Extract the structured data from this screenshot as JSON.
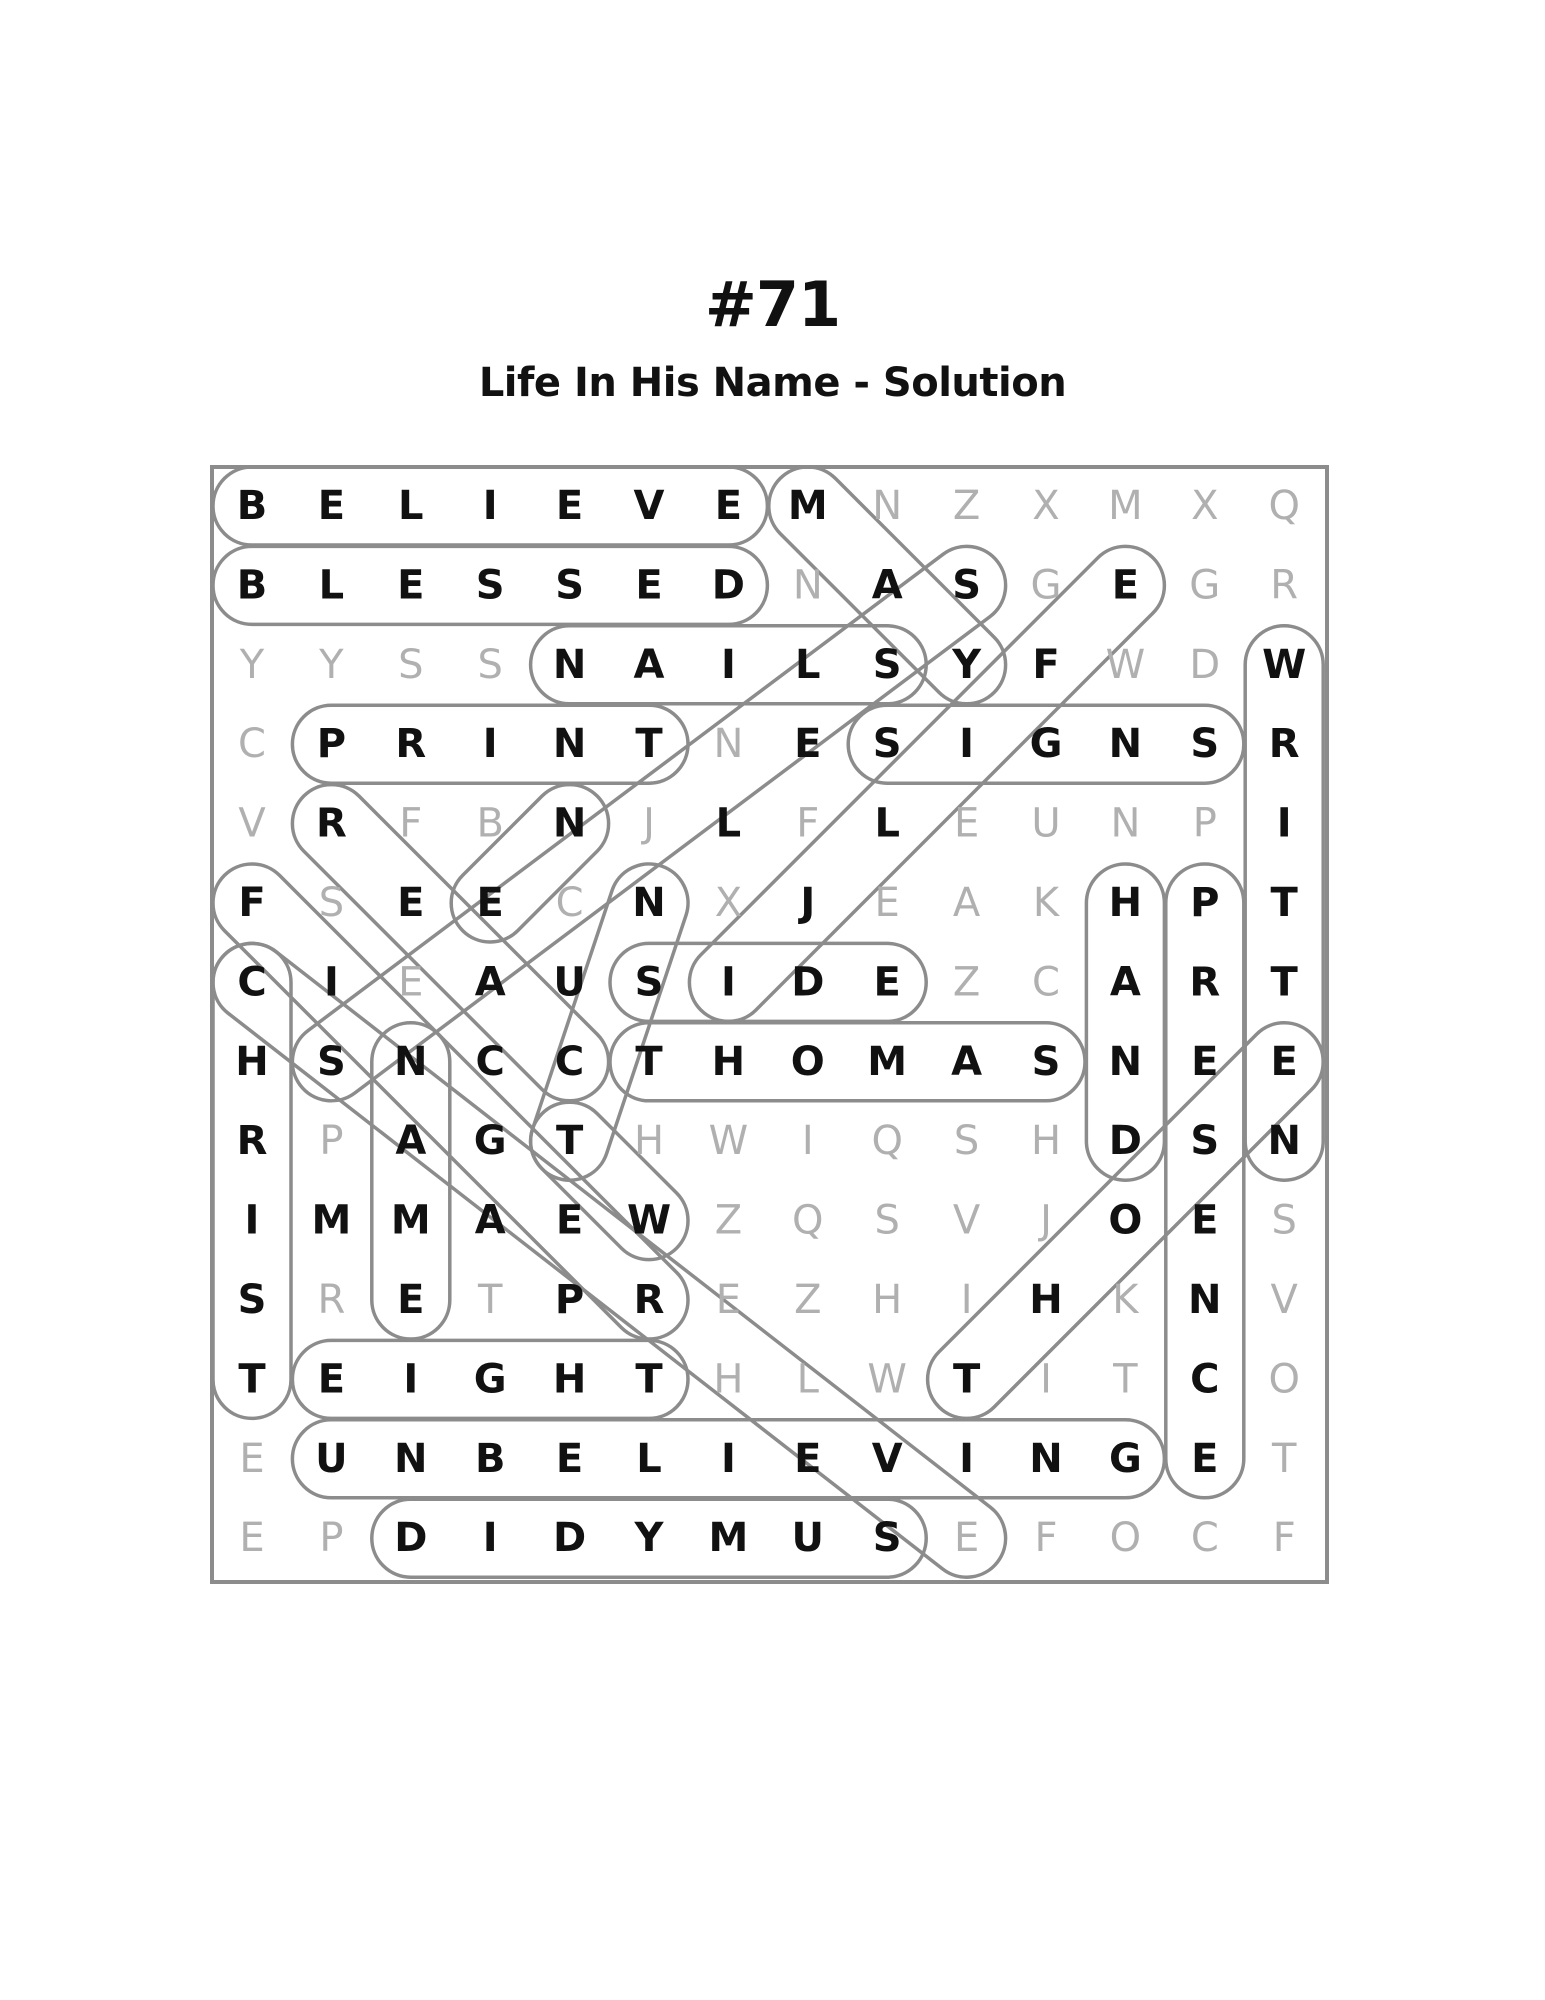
{
  "puzzle": {
    "number": "#71",
    "title": "Life In His Name - Solution"
  },
  "grid": {
    "rows": [
      "BELIEVEMNZXMXQ",
      "BLESSEDNASGEGR",
      "YYSSNAILSYFWDW",
      "CPRINTNESIGNSR",
      "VRFBNJLFLEUNPI",
      "FSEECNXJEAKHPT",
      "CIEAUSIDEZCART",
      "HSNCCTHOMASNEE",
      "RPAGTHWIQSHDSN",
      "IMMAEWZQSVJOES",
      "SRETPREZHIHKNV",
      "TEIGHTHLWTITCO",
      "EUNBELIEVINGET",
      "EPDIDYMUSEFOCF"
    ]
  },
  "solution": {
    "words": [
      {
        "word": "BELIEVE",
        "start": [
          0,
          0
        ],
        "end": [
          0,
          6
        ]
      },
      {
        "word": "BLESSED",
        "start": [
          1,
          0
        ],
        "end": [
          1,
          6
        ]
      },
      {
        "word": "NAILS",
        "start": [
          2,
          4
        ],
        "end": [
          2,
          8
        ]
      },
      {
        "word": "PRINT",
        "start": [
          3,
          1
        ],
        "end": [
          3,
          5
        ]
      },
      {
        "word": "SIGNS",
        "start": [
          3,
          8
        ],
        "end": [
          3,
          12
        ]
      },
      {
        "word": "SIDE",
        "start": [
          6,
          5
        ],
        "end": [
          6,
          8
        ]
      },
      {
        "word": "THOMAS",
        "start": [
          7,
          5
        ],
        "end": [
          7,
          10
        ]
      },
      {
        "word": "EIGHT",
        "start": [
          11,
          1
        ],
        "end": [
          11,
          5
        ]
      },
      {
        "word": "UNBELIEVING",
        "start": [
          12,
          1
        ],
        "end": [
          12,
          11
        ]
      },
      {
        "word": "DIDYMUS",
        "start": [
          13,
          2
        ],
        "end": [
          13,
          8
        ]
      },
      {
        "word": "WRITTEN",
        "start": [
          2,
          13
        ],
        "end": [
          8,
          13
        ]
      },
      {
        "word": "CHRIST",
        "start": [
          6,
          0
        ],
        "end": [
          11,
          0
        ]
      },
      {
        "word": "HAND",
        "start": [
          5,
          11
        ],
        "end": [
          8,
          11
        ]
      },
      {
        "word": "PRESENCE",
        "start": [
          5,
          12
        ],
        "end": [
          12,
          12
        ]
      },
      {
        "word": "NAME",
        "start": [
          7,
          2
        ],
        "end": [
          10,
          2
        ]
      },
      {
        "word": "MASSY",
        "start": [
          0,
          7
        ],
        "end": [
          2,
          9
        ]
      },
      {
        "word": "FEATHER",
        "start": [
          5,
          0
        ],
        "end": [
          10,
          5
        ]
      },
      {
        "word": "CIEGHE",
        "start": [
          6,
          0
        ],
        "end": [
          13,
          9
        ]
      },
      {
        "word": "SEALS",
        "start": [
          1,
          9
        ],
        "end": [
          7,
          1
        ]
      },
      {
        "word": "ESULL",
        "start": [
          1,
          11
        ],
        "end": [
          6,
          6
        ]
      },
      {
        "word": "TOE",
        "start": [
          11,
          9
        ],
        "end": [
          7,
          13
        ]
      },
      {
        "word": "RESIN",
        "start": [
          4,
          1
        ],
        "end": [
          7,
          4
        ]
      },
      {
        "word": "THE",
        "start": [
          8,
          4
        ],
        "end": [
          9,
          5
        ]
      },
      {
        "word": "NS",
        "start": [
          4,
          4
        ],
        "end": [
          5,
          3
        ]
      },
      {
        "word": "TN",
        "start": [
          8,
          4
        ],
        "end": [
          5,
          5
        ]
      }
    ]
  }
}
